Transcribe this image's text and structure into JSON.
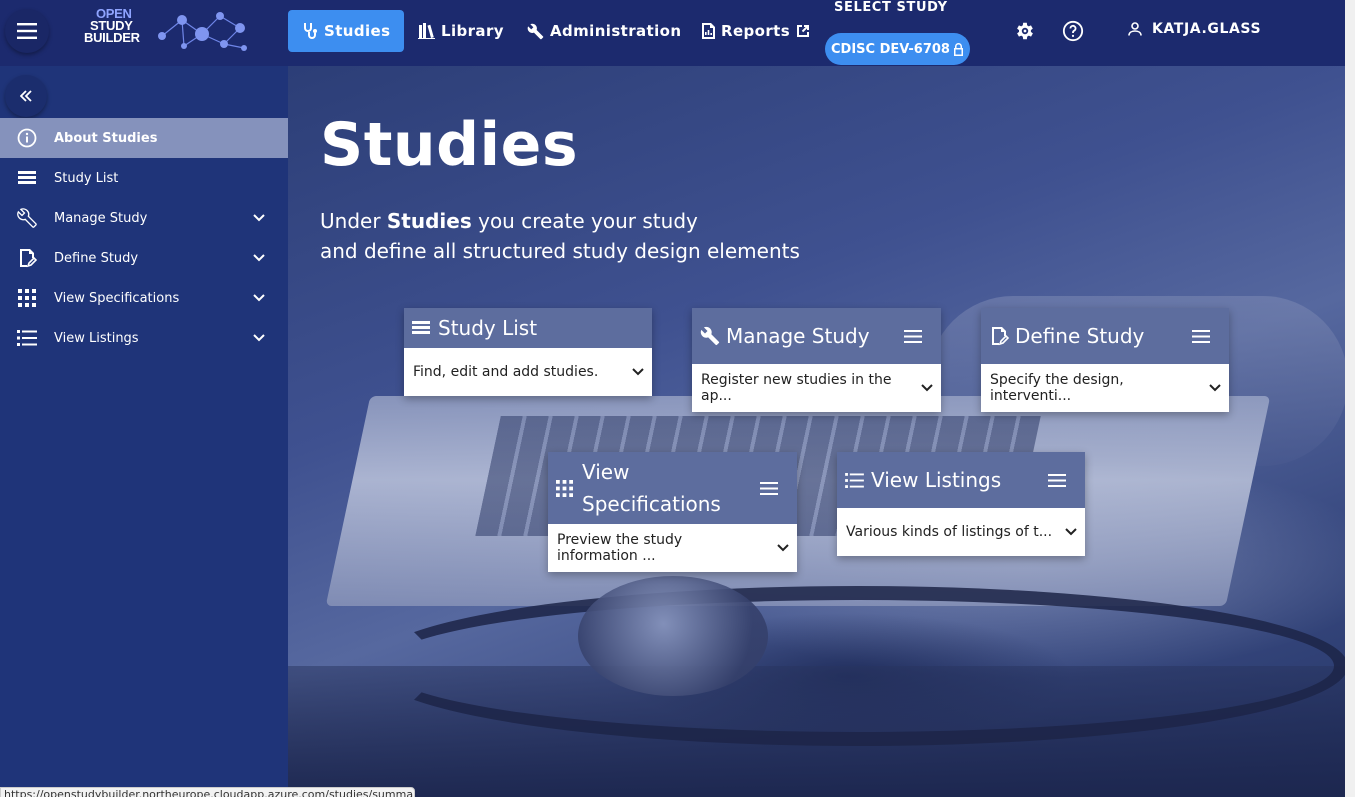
{
  "header": {
    "logo_lines": [
      "OPEN",
      "STUDY",
      "BUILDER"
    ],
    "nav": [
      {
        "label": "Studies",
        "icon": "stethoscope-icon",
        "active": true
      },
      {
        "label": "Library",
        "icon": "library-icon",
        "active": false
      },
      {
        "label": "Administration",
        "icon": "wrench-icon",
        "active": false
      },
      {
        "label": "Reports",
        "icon": "report-icon",
        "active": false
      }
    ],
    "select_study_label": "SELECT STUDY",
    "study_chip": "CDISC DEV-6708",
    "user": "KATJA.GLASS"
  },
  "sidebar": {
    "items": [
      {
        "label": "About Studies",
        "icon": "info-icon",
        "active": true,
        "expandable": false
      },
      {
        "label": "Study List",
        "icon": "list-icon",
        "active": false,
        "expandable": false
      },
      {
        "label": "Manage Study",
        "icon": "wrench-icon",
        "active": false,
        "expandable": true
      },
      {
        "label": "Define Study",
        "icon": "edit-note-icon",
        "active": false,
        "expandable": true
      },
      {
        "label": "View Specifications",
        "icon": "grid-icon",
        "active": false,
        "expandable": true
      },
      {
        "label": "View Listings",
        "icon": "bullet-list-icon",
        "active": false,
        "expandable": true
      }
    ]
  },
  "main": {
    "title": "Studies",
    "subtitle_pre": "Under ",
    "subtitle_bold": "Studies",
    "subtitle_post": " you create your study",
    "subtitle_line2": "and define all structured study design elements",
    "cards": [
      {
        "title": "Study List",
        "icon": "list-icon",
        "text": "Find, edit and add studies.",
        "has_menu": false
      },
      {
        "title": "Manage Study",
        "icon": "wrench-icon",
        "text": "Register new studies in the ap...",
        "has_menu": true
      },
      {
        "title": "Define Study",
        "icon": "edit-note-icon",
        "text": "Specify the design, interventi...",
        "has_menu": true
      },
      {
        "title": "View Specifications",
        "icon": "grid-icon",
        "text": "Preview the study information ...",
        "has_menu": true
      },
      {
        "title": "View Listings",
        "icon": "bullet-list-icon",
        "text": "Various kinds of listings of t...",
        "has_menu": true
      }
    ]
  },
  "status_bar": "https://openstudybuilder.northeurope.cloudapp.azure.com/studies/summary",
  "colors": {
    "topbar": "#1c2a6e",
    "sidebar": "#1f3479",
    "active_nav": "#3d8ef0",
    "active_side": "#8592bc",
    "card_header": "#5d6d9e"
  }
}
